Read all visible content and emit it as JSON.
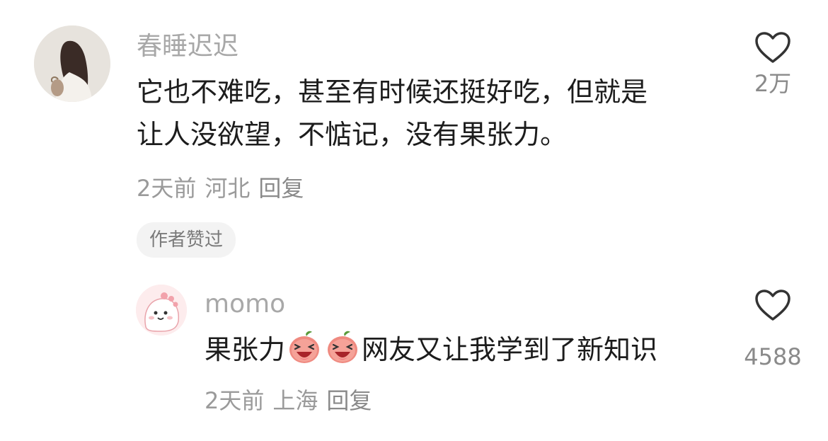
{
  "comments": [
    {
      "author": "春睡迟迟",
      "text": "它也不难吃，甚至有时候还挺好吃，但就是\n让人没欲望，不惦记，没有果张力。",
      "time": "2天前",
      "location": "河北",
      "reply_label": "回复",
      "likes": "2万",
      "badge": "作者赞过",
      "avatar_icon": "woman-back-avatar"
    },
    {
      "author": "momo",
      "text_before": "果张力",
      "text_after": "网友又让我学到了新知识",
      "emojis": [
        "laughing-peach-emoji",
        "laughing-peach-emoji"
      ],
      "time": "2天前",
      "location": "上海",
      "reply_label": "回复",
      "likes": "4588",
      "avatar_icon": "pink-dino-avatar"
    }
  ],
  "colors": {
    "author": "#a8a8a8",
    "text": "#1c1c1c",
    "meta": "#9a9a9a",
    "badge_bg": "#f3f3f3"
  }
}
